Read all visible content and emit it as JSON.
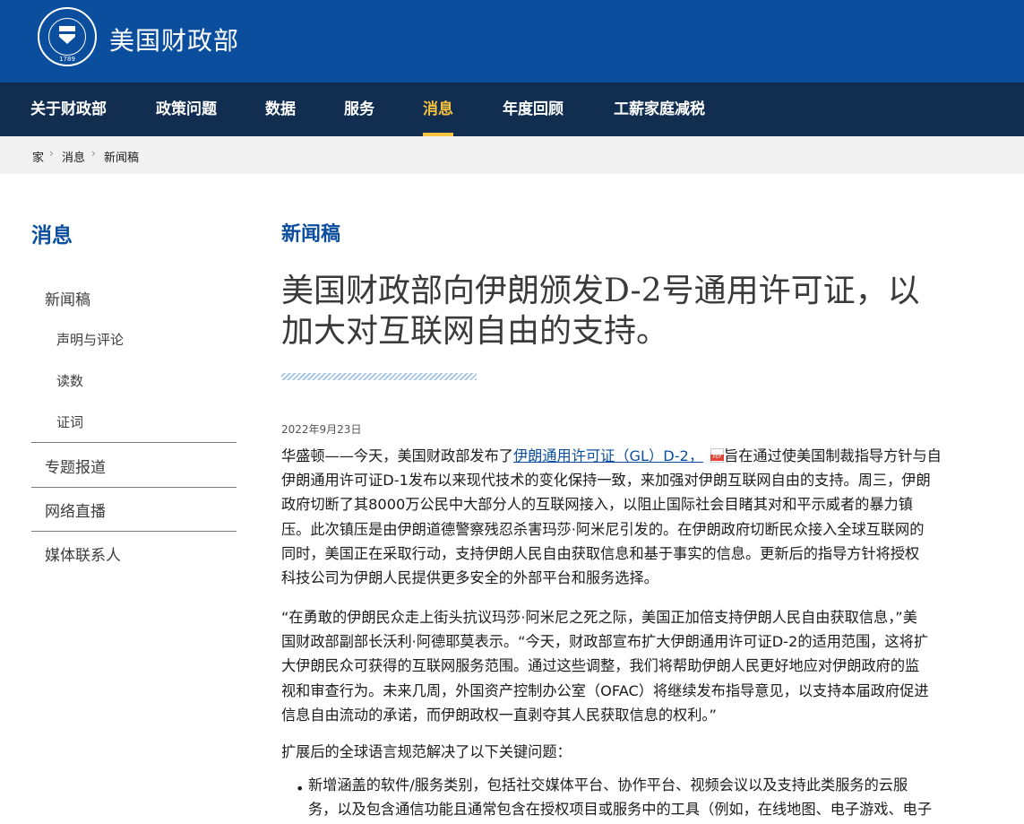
{
  "header": {
    "site_title": "美国财政部",
    "seal_year": "1789"
  },
  "nav": {
    "items": [
      "关于财政部",
      "政策问题",
      "数据",
      "服务",
      "消息",
      "年度回顾",
      "工薪家庭减税"
    ],
    "active": "消息",
    "accent_color": "#f7c23d"
  },
  "breadcrumb": [
    "家",
    "消息",
    "新闻稿"
  ],
  "sidebar": {
    "title": "消息",
    "items": [
      "新闻稿",
      "专题报道",
      "网络直播",
      "媒体联系人"
    ],
    "subitems": [
      "声明与评论",
      "读数",
      "证词"
    ]
  },
  "article": {
    "section": "新闻稿",
    "title_lines": [
      "美国财政部向伊朗颁发D-2号通用许可证，以",
      "加大对互联网自由的支持。"
    ],
    "date": "2022年9月23日",
    "p1_prefix": "华盛顿——今天，美国财政部发布了",
    "p1_link": "伊朗通用许可证（GL）D-2，",
    "p1_lines": [
      "旨在通过使美国制裁指导方针与自",
      "伊朗通用许可证D-1发布以来现代技术的变化保持一致，来加强对伊朗互联网自由的支持。周三，伊朗",
      "政府切断了其8000万公民中大部分人的互联网接入，以阻止国际社会目睹其对和平示威者的暴力镇",
      "压。此次镇压是由伊朗道德警察残忍杀害玛莎·阿米尼引发的。在伊朗政府切断民众接入全球互联网的",
      "同时，美国正在采取行动，支持伊朗人民自由获取信息和基于事实的信息。更新后的指导方针将授权",
      "科技公司为伊朗人民提供更多安全的外部平台和服务选择。"
    ],
    "p2_lines": [
      "“在勇敢的伊朗民众走上街头抗议玛莎·阿米尼之死之际，美国正加倍支持伊朗人民自由获取信息，”美",
      "国财政部副部长沃利·阿德耶莫表示。“今天，财政部宣布扩大伊朗通用许可证D-2的适用范围，这将扩",
      "大伊朗民众可获得的互联网服务范围。通过这些调整，我们将帮助伊朗人民更好地应对伊朗政府的监",
      "视和审查行为。未来几周，外国资产控制办公室（OFAC）将继续发布指导意见，以支持本届政府促进",
      "信息自由流动的承诺，而伊朗政权一直剥夺其人民获取信息的权利。”"
    ],
    "p3": "扩展后的全球语言规范解决了以下关键问题：",
    "bullet_lines": [
      "新增涵盖的软件/服务类别，包括社交媒体平台、协作平台、视频会议以及支持此类服务的云服",
      "务，以及包含通信功能且通常包含在授权项目或服务中的工具（例如，在线地图、电子游戏、电子"
    ]
  },
  "colors": {
    "brand_blue": "#0b4e9e",
    "nav_dark": "#112e51",
    "breadcrumb_bg": "#f1f1f1"
  }
}
